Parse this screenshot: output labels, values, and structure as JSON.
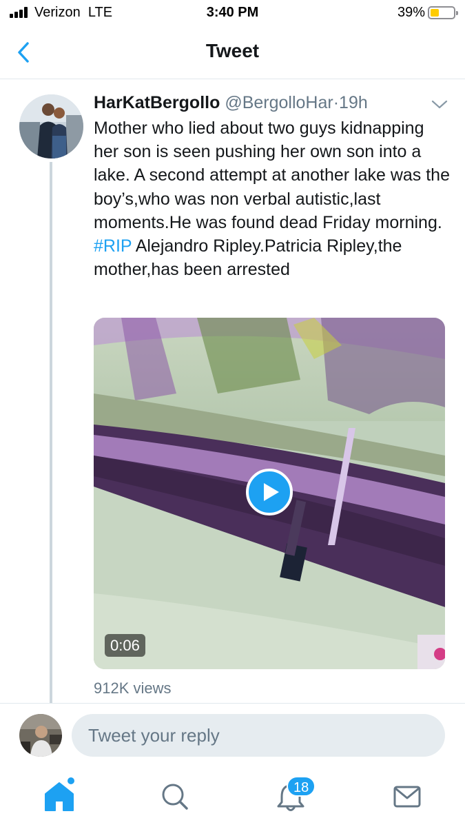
{
  "status_bar": {
    "carrier": "Verizon",
    "network": "LTE",
    "time": "3:40 PM",
    "battery_percent": "39%",
    "battery_level": 0.39,
    "signal_bars": 4
  },
  "nav": {
    "title": "Tweet",
    "back_icon": "chevron-left-icon"
  },
  "tweet": {
    "display_name": "HarKatBergollo",
    "handle": "@BergolloHar",
    "separator": "·",
    "time": "19h",
    "text_before_hashtag": "Mother who lied about two guys kidnapping her son is seen pushing her own son into a lake.  A second attempt at another lake was the boy’s,who was non verbal autistic,last moments.He was found dead Friday morning. ",
    "hashtag": "#RIP",
    "text_after_hashtag": " Alejandro Ripley.Patricia Ripley,the mother,has been arrested",
    "video_duration": "0:06",
    "views": "912K views"
  },
  "reply": {
    "placeholder": "Tweet your reply"
  },
  "tabs": {
    "home_icon": "home-icon",
    "search_icon": "search-icon",
    "notifications_icon": "bell-icon",
    "notifications_count": "18",
    "messages_icon": "envelope-icon"
  },
  "colors": {
    "accent": "#1da1f2",
    "text": "#14171a",
    "secondary_text": "#657786",
    "divider": "#e1e8ed",
    "input_bg": "#e6ecf0",
    "battery": "#ffcc00"
  }
}
